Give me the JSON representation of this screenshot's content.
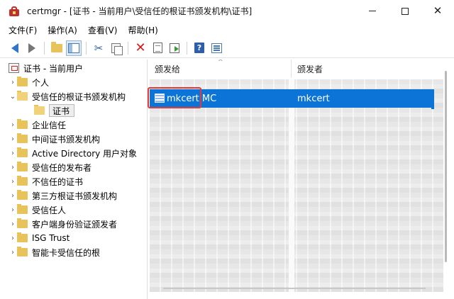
{
  "window": {
    "title": "certmgr - [证书 - 当前用户\\受信任的根证书颁发机构\\证书]",
    "minimize": "–",
    "maximize": "",
    "close": "✕"
  },
  "menu": [
    "文件(F)",
    "操作(A)",
    "查看(V)",
    "帮助(H)"
  ],
  "toolbar": {
    "icons": [
      "back-arrow-icon",
      "forward-arrow-icon",
      "up-folder-icon",
      "show-hide-tree-icon",
      "cut-icon",
      "copy-icon",
      "delete-icon",
      "properties-icon",
      "export-list-icon",
      "help-icon",
      "view-icon"
    ]
  },
  "tree": {
    "root": "证书 - 当前用户",
    "items": [
      {
        "label": "个人",
        "expanded": false
      },
      {
        "label": "受信任的根证书颁发机构",
        "expanded": true
      },
      {
        "label": "证书",
        "selected": true
      },
      {
        "label": "企业信任",
        "expanded": false
      },
      {
        "label": "中间证书颁发机构",
        "expanded": false
      },
      {
        "label": "Active Directory 用户对象",
        "expanded": false
      },
      {
        "label": "受信任的发布者",
        "expanded": false
      },
      {
        "label": "不信任的证书",
        "expanded": false
      },
      {
        "label": "第三方根证书颁发机构",
        "expanded": false
      },
      {
        "label": "受信任人",
        "expanded": false
      },
      {
        "label": "客户端身份验证颁发者",
        "expanded": false
      },
      {
        "label": "ISG Trust",
        "expanded": false
      },
      {
        "label": "智能卡受信任的根",
        "expanded": false
      }
    ]
  },
  "list": {
    "columns": [
      "颁发给",
      "颁发者"
    ],
    "selected_row": {
      "issued_to": "mkcert MC",
      "issued_by": "mkcert"
    }
  },
  "colors": {
    "selection": "#0c74d6",
    "highlight_box": "#e03a3a",
    "folder": "#e8c25b"
  }
}
